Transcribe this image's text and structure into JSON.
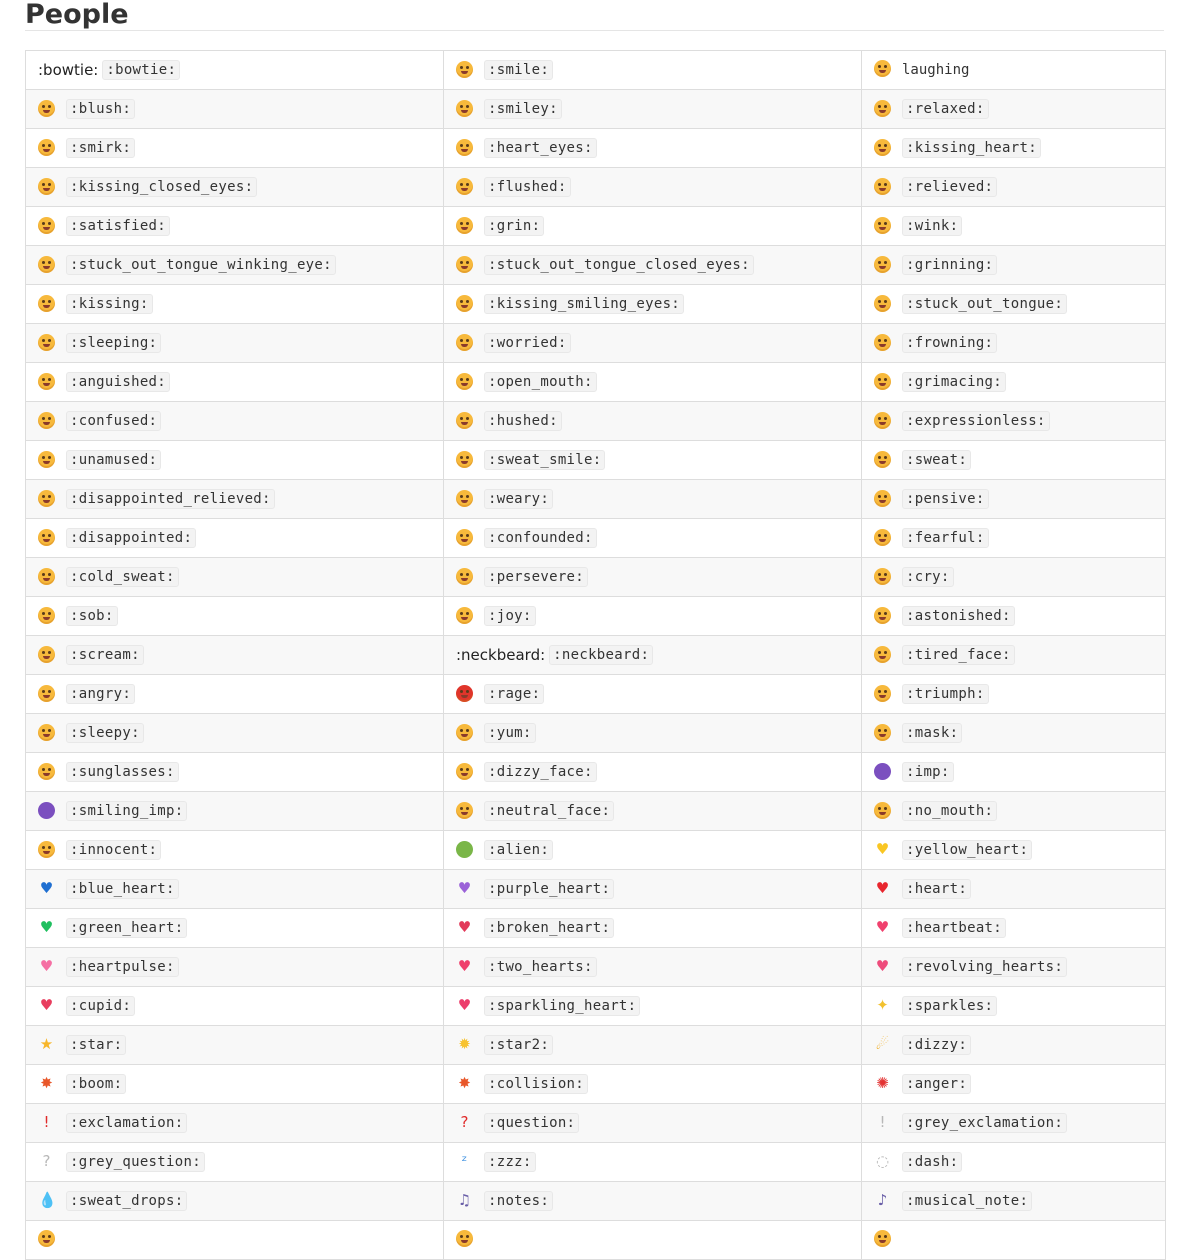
{
  "heading": "People",
  "emoji_rows": [
    [
      {
        "text_emoji": ":bowtie:",
        "code": ":bowtie:"
      },
      {
        "icon": "smile-icon",
        "kind": "face",
        "code": ":smile:"
      },
      {
        "icon": "laughing-icon",
        "kind": "face",
        "code": "laughing",
        "plain": true
      }
    ],
    [
      {
        "icon": "blush-icon",
        "kind": "face",
        "code": ":blush:"
      },
      {
        "icon": "smiley-icon",
        "kind": "face",
        "code": ":smiley:"
      },
      {
        "icon": "relaxed-icon",
        "kind": "face",
        "code": ":relaxed:"
      }
    ],
    [
      {
        "icon": "smirk-icon",
        "kind": "face",
        "code": ":smirk:"
      },
      {
        "icon": "heart-eyes-icon",
        "kind": "face",
        "code": ":heart_eyes:"
      },
      {
        "icon": "kissing-heart-icon",
        "kind": "face",
        "code": ":kissing_heart:"
      }
    ],
    [
      {
        "icon": "kissing-closed-eyes-icon",
        "kind": "face",
        "code": ":kissing_closed_eyes:"
      },
      {
        "icon": "flushed-icon",
        "kind": "face",
        "code": ":flushed:"
      },
      {
        "icon": "relieved-icon",
        "kind": "face",
        "code": ":relieved:"
      }
    ],
    [
      {
        "icon": "satisfied-icon",
        "kind": "face",
        "code": ":satisfied:"
      },
      {
        "icon": "grin-icon",
        "kind": "face",
        "code": ":grin:"
      },
      {
        "icon": "wink-icon",
        "kind": "face",
        "code": ":wink:"
      }
    ],
    [
      {
        "icon": "stuck-out-tongue-winking-eye-icon",
        "kind": "face",
        "code": ":stuck_out_tongue_winking_eye:"
      },
      {
        "icon": "stuck-out-tongue-closed-eyes-icon",
        "kind": "face",
        "code": ":stuck_out_tongue_closed_eyes:"
      },
      {
        "icon": "grinning-icon",
        "kind": "face",
        "code": ":grinning:"
      }
    ],
    [
      {
        "icon": "kissing-icon",
        "kind": "face",
        "code": ":kissing:"
      },
      {
        "icon": "kissing-smiling-eyes-icon",
        "kind": "face",
        "code": ":kissing_smiling_eyes:"
      },
      {
        "icon": "stuck-out-tongue-icon",
        "kind": "face",
        "code": ":stuck_out_tongue:"
      }
    ],
    [
      {
        "icon": "sleeping-icon",
        "kind": "face",
        "code": ":sleeping:"
      },
      {
        "icon": "worried-icon",
        "kind": "face",
        "code": ":worried:"
      },
      {
        "icon": "frowning-icon",
        "kind": "face",
        "code": ":frowning:"
      }
    ],
    [
      {
        "icon": "anguished-icon",
        "kind": "face",
        "code": ":anguished:"
      },
      {
        "icon": "open-mouth-icon",
        "kind": "face",
        "code": ":open_mouth:"
      },
      {
        "icon": "grimacing-icon",
        "kind": "face",
        "code": ":grimacing:"
      }
    ],
    [
      {
        "icon": "confused-icon",
        "kind": "face",
        "code": ":confused:"
      },
      {
        "icon": "hushed-icon",
        "kind": "face",
        "code": ":hushed:"
      },
      {
        "icon": "expressionless-icon",
        "kind": "face",
        "code": ":expressionless:"
      }
    ],
    [
      {
        "icon": "unamused-icon",
        "kind": "face",
        "code": ":unamused:"
      },
      {
        "icon": "sweat-smile-icon",
        "kind": "face",
        "code": ":sweat_smile:"
      },
      {
        "icon": "sweat-icon",
        "kind": "face",
        "code": ":sweat:"
      }
    ],
    [
      {
        "icon": "disappointed-relieved-icon",
        "kind": "face",
        "code": ":disappointed_relieved:"
      },
      {
        "icon": "weary-icon",
        "kind": "face",
        "code": ":weary:"
      },
      {
        "icon": "pensive-icon",
        "kind": "face",
        "code": ":pensive:"
      }
    ],
    [
      {
        "icon": "disappointed-icon",
        "kind": "face",
        "code": ":disappointed:"
      },
      {
        "icon": "confounded-icon",
        "kind": "face",
        "code": ":confounded:"
      },
      {
        "icon": "fearful-icon",
        "kind": "face",
        "code": ":fearful:"
      }
    ],
    [
      {
        "icon": "cold-sweat-icon",
        "kind": "face",
        "code": ":cold_sweat:"
      },
      {
        "icon": "persevere-icon",
        "kind": "face",
        "code": ":persevere:"
      },
      {
        "icon": "cry-icon",
        "kind": "face",
        "code": ":cry:"
      }
    ],
    [
      {
        "icon": "sob-icon",
        "kind": "face",
        "code": ":sob:"
      },
      {
        "icon": "joy-icon",
        "kind": "face",
        "code": ":joy:"
      },
      {
        "icon": "astonished-icon",
        "kind": "face",
        "code": ":astonished:"
      }
    ],
    [
      {
        "icon": "scream-icon",
        "kind": "face",
        "code": ":scream:"
      },
      {
        "text_emoji": ":neckbeard:",
        "code": ":neckbeard:"
      },
      {
        "icon": "tired-face-icon",
        "kind": "face",
        "code": ":tired_face:"
      }
    ],
    [
      {
        "icon": "angry-icon",
        "kind": "face",
        "code": ":angry:"
      },
      {
        "icon": "rage-icon",
        "kind": "face",
        "code": ":rage:",
        "color": "#e0352b"
      },
      {
        "icon": "triumph-icon",
        "kind": "face",
        "code": ":triumph:"
      }
    ],
    [
      {
        "icon": "sleepy-icon",
        "kind": "face",
        "code": ":sleepy:"
      },
      {
        "icon": "yum-icon",
        "kind": "face",
        "code": ":yum:"
      },
      {
        "icon": "mask-icon",
        "kind": "face",
        "code": ":mask:"
      }
    ],
    [
      {
        "icon": "sunglasses-icon",
        "kind": "face",
        "code": ":sunglasses:"
      },
      {
        "icon": "dizzy-face-icon",
        "kind": "face",
        "code": ":dizzy_face:"
      },
      {
        "icon": "imp-icon",
        "kind": "purple",
        "code": ":imp:"
      }
    ],
    [
      {
        "icon": "smiling-imp-icon",
        "kind": "purple",
        "code": ":smiling_imp:"
      },
      {
        "icon": "neutral-face-icon",
        "kind": "face",
        "code": ":neutral_face:"
      },
      {
        "icon": "no-mouth-icon",
        "kind": "face",
        "code": ":no_mouth:"
      }
    ],
    [
      {
        "icon": "innocent-icon",
        "kind": "face",
        "code": ":innocent:"
      },
      {
        "icon": "alien-icon",
        "kind": "alien",
        "code": ":alien:"
      },
      {
        "icon": "yellow-heart-icon",
        "kind": "glyph",
        "glyph": "♥",
        "color": "#f9c623",
        "code": ":yellow_heart:"
      }
    ],
    [
      {
        "icon": "blue-heart-icon",
        "kind": "glyph",
        "glyph": "♥",
        "color": "#1f6fd1",
        "code": ":blue_heart:"
      },
      {
        "icon": "purple-heart-icon",
        "kind": "glyph",
        "glyph": "♥",
        "color": "#9b62d8",
        "code": ":purple_heart:"
      },
      {
        "icon": "heart-icon",
        "kind": "glyph",
        "glyph": "♥",
        "color": "#e8262e",
        "code": ":heart:"
      }
    ],
    [
      {
        "icon": "green-heart-icon",
        "kind": "glyph",
        "glyph": "♥",
        "color": "#1fbf5f",
        "code": ":green_heart:"
      },
      {
        "icon": "broken-heart-icon",
        "kind": "glyph",
        "glyph": "♥",
        "color": "#e23a5a",
        "code": ":broken_heart:"
      },
      {
        "icon": "heartbeat-icon",
        "kind": "glyph",
        "glyph": "♥",
        "color": "#f0416e",
        "code": ":heartbeat:"
      }
    ],
    [
      {
        "icon": "heartpulse-icon",
        "kind": "glyph",
        "glyph": "♥",
        "color": "#f56fa3",
        "code": ":heartpulse:"
      },
      {
        "icon": "two-hearts-icon",
        "kind": "glyph",
        "glyph": "♥",
        "color": "#ef3f6b",
        "code": ":two_hearts:"
      },
      {
        "icon": "revolving-hearts-icon",
        "kind": "glyph",
        "glyph": "♥",
        "color": "#ee4c7c",
        "code": ":revolving_hearts:"
      }
    ],
    [
      {
        "icon": "cupid-icon",
        "kind": "glyph",
        "glyph": "♥",
        "color": "#e83d5e",
        "code": ":cupid:"
      },
      {
        "icon": "sparkling-heart-icon",
        "kind": "glyph",
        "glyph": "♥",
        "color": "#ec3d6b",
        "code": ":sparkling_heart:"
      },
      {
        "icon": "sparkles-icon",
        "kind": "glyph",
        "glyph": "✦",
        "color": "#f2c12e",
        "code": ":sparkles:"
      }
    ],
    [
      {
        "icon": "star-icon",
        "kind": "glyph",
        "glyph": "★",
        "color": "#f7b62a",
        "code": ":star:"
      },
      {
        "icon": "star2-icon",
        "kind": "glyph",
        "glyph": "✹",
        "color": "#f7c330",
        "code": ":star2:"
      },
      {
        "icon": "dizzy-icon",
        "kind": "glyph",
        "glyph": "☄",
        "color": "#f0b12e",
        "code": ":dizzy:"
      }
    ],
    [
      {
        "icon": "boom-icon",
        "kind": "glyph",
        "glyph": "✸",
        "color": "#e8572a",
        "code": ":boom:"
      },
      {
        "icon": "collision-icon",
        "kind": "glyph",
        "glyph": "✸",
        "color": "#e8572a",
        "code": ":collision:"
      },
      {
        "icon": "anger-icon",
        "kind": "glyph",
        "glyph": "✺",
        "color": "#e33232",
        "code": ":anger:"
      }
    ],
    [
      {
        "icon": "exclamation-icon",
        "kind": "glyph",
        "glyph": "!",
        "color": "#e02b2b",
        "code": ":exclamation:"
      },
      {
        "icon": "question-icon",
        "kind": "glyph",
        "glyph": "?",
        "color": "#e02b2b",
        "code": ":question:"
      },
      {
        "icon": "grey-exclamation-icon",
        "kind": "glyph",
        "glyph": "!",
        "color": "#b8b8b8",
        "code": ":grey_exclamation:"
      }
    ],
    [
      {
        "icon": "grey-question-icon",
        "kind": "glyph",
        "glyph": "?",
        "color": "#b8b8b8",
        "code": ":grey_question:"
      },
      {
        "icon": "zzz-icon",
        "kind": "glyph",
        "glyph": "ᶻ",
        "color": "#3b8fe0",
        "code": ":zzz:"
      },
      {
        "icon": "dash-icon",
        "kind": "glyph",
        "glyph": "◌",
        "color": "#b5b5b5",
        "code": ":dash:"
      }
    ],
    [
      {
        "icon": "sweat-drops-icon",
        "kind": "glyph",
        "glyph": "💧",
        "color": "#2a9bea",
        "code": ":sweat_drops:"
      },
      {
        "icon": "notes-icon",
        "kind": "glyph",
        "glyph": "♫",
        "color": "#6a5fa8",
        "code": ":notes:"
      },
      {
        "icon": "musical-note-icon",
        "kind": "glyph",
        "glyph": "♪",
        "color": "#6a5fa8",
        "code": ":musical_note:"
      }
    ],
    [
      {
        "icon": "fire-icon",
        "kind": "face",
        "code": ""
      },
      {
        "icon": "hankey-icon",
        "kind": "face",
        "code": ""
      },
      {
        "icon": "poop-icon",
        "kind": "face",
        "code": ""
      }
    ]
  ]
}
